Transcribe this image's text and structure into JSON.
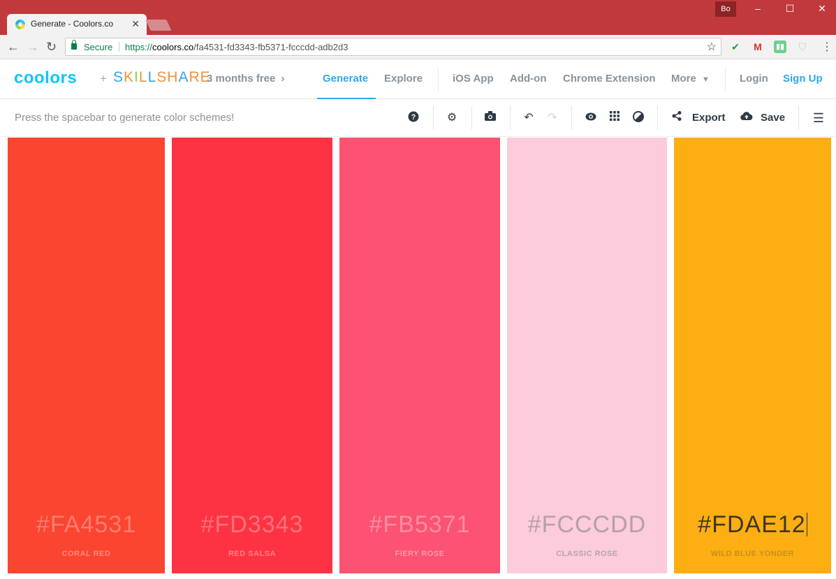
{
  "browser": {
    "tab_title": "Generate - Coolors.co",
    "tab_close": "✕",
    "profile": "Bo",
    "secure_label": "Secure",
    "url_scheme": "https://",
    "url_host": "coolors.co",
    "url_path": "/fa4531-fd3343-fb5371-fcccdd-adb2d3",
    "window_controls": [
      "–",
      "☐",
      "✕"
    ],
    "extensions": [
      {
        "icon": "check-icon",
        "color": "#1aa235"
      },
      {
        "icon": "gmail-icon",
        "color": "#d93025"
      },
      {
        "icon": "audio-icon",
        "color": "#6fd08f"
      },
      {
        "icon": "shield-icon",
        "color": "#c8c8c8"
      }
    ]
  },
  "header": {
    "logo": "coolors",
    "plus": "+",
    "partner": "SKILLSHARE",
    "promo": "3 months free",
    "nav": [
      "Generate",
      "Explore",
      "iOS App",
      "Add-on",
      "Chrome Extension",
      "More"
    ],
    "active_nav": "Generate",
    "login": "Login",
    "signup": "Sign Up"
  },
  "toolbar": {
    "hint": "Press the spacebar to generate color schemes!",
    "export_label": "Export",
    "save_label": "Save",
    "icons": [
      "help-icon",
      "settings-icon",
      "camera-icon",
      "undo-icon",
      "redo-icon",
      "view-icon",
      "grid-icon",
      "contrast-icon",
      "share-icon",
      "cloud-upload-icon",
      "menu-icon"
    ]
  },
  "palette": [
    {
      "hex": "#FA4531",
      "name": "CORAL RED",
      "bg": "#fa4531",
      "text_color": "#fc7d6e",
      "name_color": "#fc8a7b"
    },
    {
      "hex": "#FD3343",
      "name": "RED SALSA",
      "bg": "#fd3343",
      "text_color": "#fe707b",
      "name_color": "#fe7e88"
    },
    {
      "hex": "#FB5371",
      "name": "FIERY ROSE",
      "bg": "#fb5371",
      "text_color": "#fd8da1",
      "name_color": "#fd98aa"
    },
    {
      "hex": "#FCCCDD",
      "name": "CLASSIC ROSE",
      "bg": "#fccbdc",
      "text_color": "#b5a0a8",
      "name_color": "#b3a5aa"
    },
    {
      "hex": "#FDAE12",
      "name": "WILD BLUE YONDER",
      "bg": "#fdae12",
      "text_color": "#3e3720",
      "name_color": "#c78f1f"
    }
  ]
}
